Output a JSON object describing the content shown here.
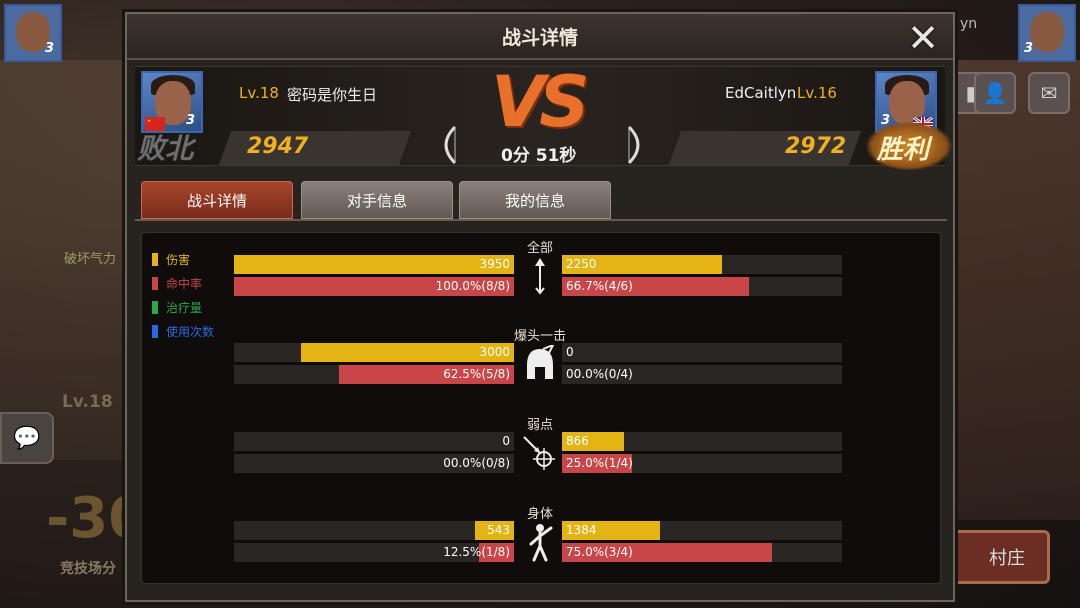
{
  "background": {
    "left_label": "破坏气力",
    "left_level": "Lv.18",
    "left_big_number": "-30",
    "left_caption": "竞技场分",
    "village_button": "村庄",
    "top_left_rank": "3",
    "top_right_rank": "3",
    "top_right_name": "yn"
  },
  "dialog": {
    "title": "战斗详情",
    "close_label": "✕"
  },
  "match": {
    "left": {
      "level": "Lv.18",
      "name": "密码是你生日",
      "rank": "3",
      "score": "2947",
      "result": "败北",
      "flag": "CN"
    },
    "right": {
      "name": "EdCaitlyn",
      "level": "Lv.16",
      "rank": "3",
      "score": "2972",
      "result": "胜利",
      "flag": "UK"
    },
    "vs_label": "VS",
    "duration": "0分 51秒"
  },
  "tabs": [
    {
      "label": "战斗详情",
      "active": true
    },
    {
      "label": "对手信息",
      "active": false
    },
    {
      "label": "我的信息",
      "active": false
    }
  ],
  "legend": [
    {
      "label": "伤害",
      "color": "#e4b414"
    },
    {
      "label": "命中率",
      "color": "#c84648"
    },
    {
      "label": "治疗量",
      "color": "#2aa84a"
    },
    {
      "label": "使用次数",
      "color": "#2a6ae0"
    }
  ],
  "sections": [
    {
      "title": "全部",
      "icon": "arrow-icon",
      "left": {
        "damage": "3950",
        "damage_fraction": 1.0,
        "hit": "100.0%(8/8)",
        "hit_fraction": 1.0
      },
      "right": {
        "damage": "2250",
        "damage_fraction": 0.57,
        "hit": "66.7%(4/6)",
        "hit_fraction": 0.667
      }
    },
    {
      "title": "爆头一击",
      "icon": "helmet-icon",
      "left": {
        "damage": "3000",
        "damage_fraction": 0.76,
        "hit": "62.5%(5/8)",
        "hit_fraction": 0.625
      },
      "right": {
        "damage": "0",
        "damage_fraction": 0,
        "hit": "00.0%(0/4)",
        "hit_fraction": 0
      }
    },
    {
      "title": "弱点",
      "icon": "crosshair-icon",
      "left": {
        "damage": "0",
        "damage_fraction": 0,
        "hit": "00.0%(0/8)",
        "hit_fraction": 0
      },
      "right": {
        "damage": "866",
        "damage_fraction": 0.22,
        "hit": "25.0%(1/4)",
        "hit_fraction": 0.25
      }
    },
    {
      "title": "身体",
      "icon": "body-icon",
      "left": {
        "damage": "543",
        "damage_fraction": 0.14,
        "hit": "12.5%(1/8)",
        "hit_fraction": 0.125
      },
      "right": {
        "damage": "1384",
        "damage_fraction": 0.35,
        "hit": "75.0%(3/4)",
        "hit_fraction": 0.75
      }
    }
  ]
}
